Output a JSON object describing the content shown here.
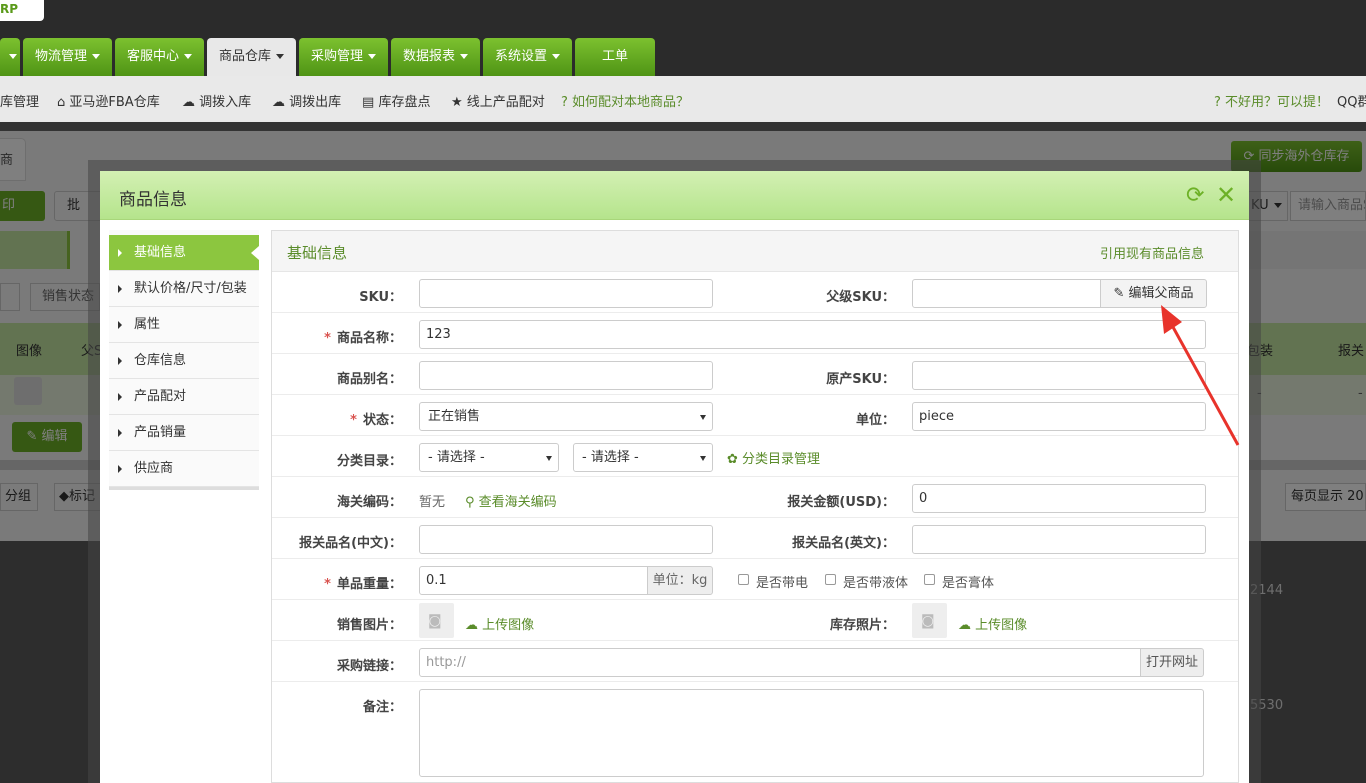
{
  "app": {
    "logo_text": "RP"
  },
  "nav": {
    "tabs": [
      {
        "label": "物流管理"
      },
      {
        "label": "客服中心"
      },
      {
        "label": "商品仓库"
      },
      {
        "label": "采购管理"
      },
      {
        "label": "数据报表"
      },
      {
        "label": "系统设置"
      },
      {
        "label": "工单"
      }
    ]
  },
  "subnav": {
    "items": [
      {
        "label": "库管理"
      },
      {
        "label": "亚马逊FBA仓库"
      },
      {
        "label": "调拨入库"
      },
      {
        "label": "调拨出库"
      },
      {
        "label": "库存盘点"
      },
      {
        "label": "线上产品配对"
      },
      {
        "label": "如何配对本地商品？"
      }
    ],
    "feedback": "不好用？可以提！",
    "qq": "QQ群"
  },
  "background": {
    "tab_label": "商品",
    "sync_button": "同步海外仓库存",
    "print_button": "印",
    "batch_button": "批",
    "sale_status": "销售状态",
    "col_image": "图像",
    "col_parent": "父S",
    "col_pack": "包装",
    "col_declare": "报关",
    "edit_button": "编辑",
    "group_button": "分组",
    "mark_button": "标记",
    "sku_select": "KU",
    "search_placeholder": "请输入商品S",
    "page_size": "每页显示 20",
    "dash1": "-",
    "dash2": "-",
    "num1": "2144",
    "num2": "5530"
  },
  "modal": {
    "title": "商品信息",
    "sidebar": [
      {
        "label": "基础信息"
      },
      {
        "label": "默认价格/尺寸/包装"
      },
      {
        "label": "属性"
      },
      {
        "label": "仓库信息"
      },
      {
        "label": "产品配对"
      },
      {
        "label": "产品销量"
      },
      {
        "label": "供应商"
      }
    ],
    "section_title": "基础信息",
    "reference_link": "引用现有商品信息",
    "form": {
      "sku_label": "SKU：",
      "sku_value": "",
      "parent_sku_label": "父级SKU：",
      "parent_sku_value": "",
      "edit_parent_button": "编辑父商品",
      "name_label": "商品名称：",
      "name_value": "123",
      "alias_label": "商品别名：",
      "alias_value": "",
      "orig_sku_label": "原产SKU：",
      "orig_sku_value": "",
      "status_label": "状态：",
      "status_value": "正在销售",
      "unit_label": "单位：",
      "unit_value": "piece",
      "category_label": "分类目录：",
      "category_select1": "- 请选择 -",
      "category_select2": "- 请选择 -",
      "category_manage": "分类目录管理",
      "hs_label": "海关编码：",
      "hs_value": "暂无",
      "hs_lookup": "查看海关编码",
      "declare_amount_label": "报关金额(USD)：",
      "declare_amount_value": "0",
      "declare_cn_label": "报关品名(中文)：",
      "declare_cn_value": "",
      "declare_en_label": "报关品名(英文)：",
      "declare_en_value": "",
      "weight_label": "单品重量：",
      "weight_value": "0.1",
      "weight_unit": "单位：kg",
      "battery_label": "是否带电",
      "liquid_label": "是否带液体",
      "paste_label": "是否膏体",
      "sale_image_label": "销售图片：",
      "upload_image": "上传图像",
      "stock_photo_label": "库存照片：",
      "upload_image2": "上传图像",
      "purchase_link_label": "采购链接：",
      "purchase_link_placeholder": "http://",
      "open_url_button": "打开网址",
      "remark_label": "备注："
    }
  },
  "colors": {
    "accent_green": "#6db127",
    "required_red": "#d9534f",
    "annotation_red": "#e8332b"
  }
}
